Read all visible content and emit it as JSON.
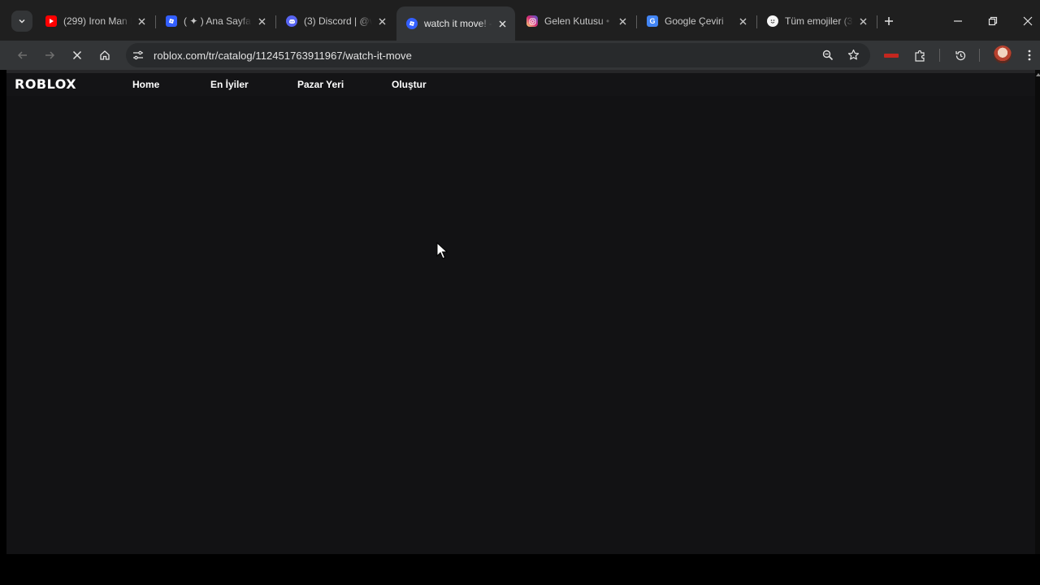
{
  "tabs": [
    {
      "title": "(299) Iron Man I",
      "icon": "youtube-icon",
      "color": "#ff0000"
    },
    {
      "title": "( ✦ ) Ana Sayfa -",
      "icon": "roblox-icon",
      "color": "#335fff"
    },
    {
      "title": "(3) Discord | @v",
      "icon": "discord-icon",
      "color": "#5865f2"
    },
    {
      "title": "watch it move! -",
      "icon": "roblox-icon",
      "color": "#335fff",
      "active": true
    },
    {
      "title": "Gelen Kutusu • I",
      "icon": "instagram-icon",
      "color": "#e1306c"
    },
    {
      "title": "Google Çeviri",
      "icon": "google-translate-icon",
      "color": "#4285f4"
    },
    {
      "title": "Tüm emojiler (3",
      "icon": "emoji-icon",
      "color": "#f5f5f5"
    }
  ],
  "address_bar": {
    "url": "roblox.com/tr/catalog/112451763911967/watch-it-move"
  },
  "roblox": {
    "logo": "ROBLOX",
    "nav": [
      "Home",
      "En İyiler",
      "Pazar Yeri",
      "Oluştur"
    ]
  },
  "colors": {
    "page_bg": "#121214",
    "chrome_dark": "#1f1f1f",
    "toolbar": "#333537"
  }
}
